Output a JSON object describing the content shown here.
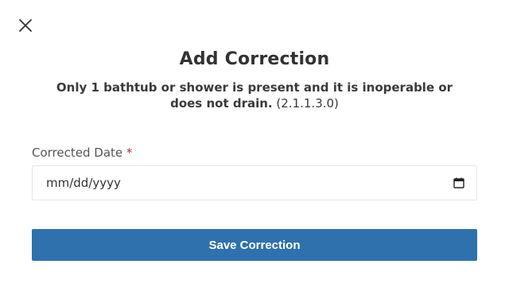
{
  "dialog": {
    "title": "Add Correction",
    "description": "Only 1 bathtub or shower is present and it is inoperable or does not drain.",
    "code": "(2.1.1.3.0)"
  },
  "form": {
    "date_label": "Corrected Date",
    "required_marker": "*",
    "date_placeholder": "mm/dd/yyyy"
  },
  "actions": {
    "save_label": "Save Correction"
  },
  "icons": {
    "close": "close-icon",
    "calendar": "calendar-icon"
  },
  "colors": {
    "primary_button": "#2e71ad",
    "required": "#b03030"
  }
}
